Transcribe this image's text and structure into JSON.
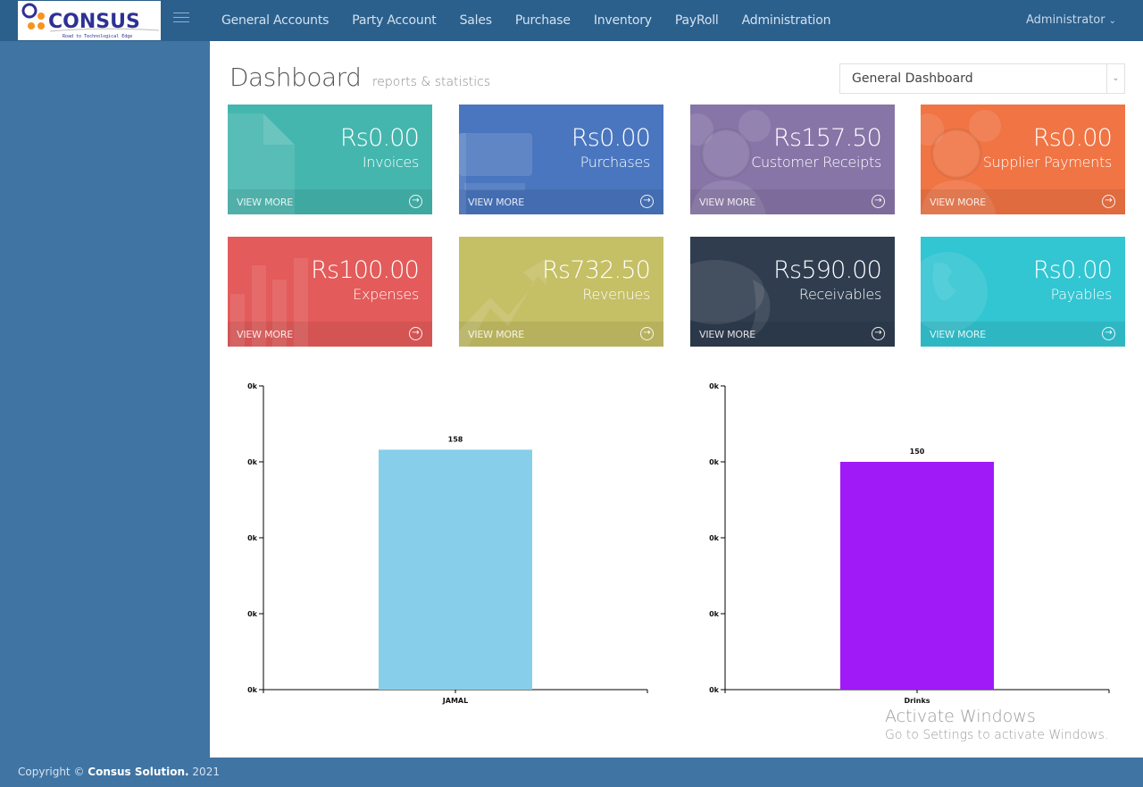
{
  "app": {
    "logo_text": "CONSUS",
    "logo_tagline": "Road to Technological Edge"
  },
  "nav": {
    "items": [
      "General Accounts",
      "Party Account",
      "Sales",
      "Purchase",
      "Inventory",
      "PayRoll",
      "Administration"
    ],
    "user": "Administrator"
  },
  "header": {
    "title": "Dashboard",
    "subtitle": "reports & statistics",
    "dashboard_select": {
      "value": "General Dashboard"
    }
  },
  "cards": [
    {
      "amount": "Rs0.00",
      "label": "Invoices",
      "link": "VIEW MORE",
      "color": "#44b6ae",
      "icon": "document-icon"
    },
    {
      "amount": "Rs0.00",
      "label": "Purchases",
      "link": "VIEW MORE",
      "color": "#4a76bf",
      "icon": "cart-icon"
    },
    {
      "amount": "Rs157.50",
      "label": "Customer Receipts",
      "link": "VIEW MORE",
      "color": "#8775a7",
      "icon": "group-icon"
    },
    {
      "amount": "Rs0.00",
      "label": "Supplier Payments",
      "link": "VIEW MORE",
      "color": "#f07444",
      "icon": "group-icon"
    },
    {
      "amount": "Rs100.00",
      "label": "Expenses",
      "link": "VIEW MORE",
      "color": "#e35b5a",
      "icon": "bar-chart-icon"
    },
    {
      "amount": "Rs732.50",
      "label": "Revenues",
      "link": "VIEW MORE",
      "color": "#c5bf66",
      "icon": "trend-up-icon"
    },
    {
      "amount": "Rs590.00",
      "label": "Receivables",
      "link": "VIEW MORE",
      "color": "#2f3d4f",
      "icon": "comments-icon"
    },
    {
      "amount": "Rs0.00",
      "label": "Payables",
      "link": "VIEW MORE",
      "color": "#32c5d2",
      "icon": "globe-icon"
    }
  ],
  "chart_data": [
    {
      "type": "bar",
      "categories": [
        "JAMAL"
      ],
      "values": [
        158
      ],
      "data_labels": [
        "158"
      ],
      "color": "#87ceeb",
      "yticks": [
        "0k",
        "0k",
        "0k",
        "0k",
        "0k"
      ],
      "ylim": [
        0,
        200
      ],
      "title": "",
      "xlabel": "",
      "ylabel": ""
    },
    {
      "type": "bar",
      "categories": [
        "Drinks"
      ],
      "values": [
        150
      ],
      "data_labels": [
        "150"
      ],
      "color": "#a01af7",
      "yticks": [
        "0k",
        "0k",
        "0k",
        "0k",
        "0k"
      ],
      "ylim": [
        0,
        200
      ],
      "title": "",
      "xlabel": "",
      "ylabel": ""
    }
  ],
  "watermark": {
    "line1": "Activate Windows",
    "line2": "Go to Settings to activate Windows."
  },
  "footer": {
    "prefix": "Copyright © ",
    "company": "Consus Solution.",
    "year": " 2021"
  }
}
